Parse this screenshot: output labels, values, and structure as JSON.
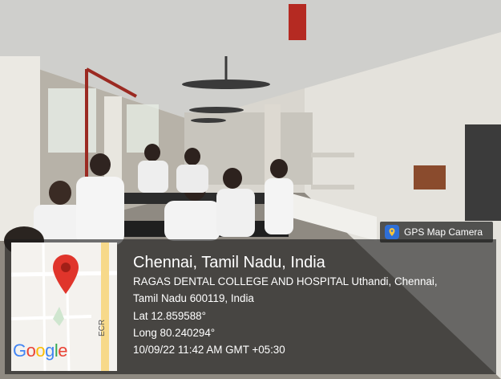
{
  "badge": {
    "label": "GPS Map Camera",
    "icon": "gps-map-camera-app-icon"
  },
  "location": {
    "city_line": "Chennai, Tamil Nadu, India",
    "address_line1": "RAGAS DENTAL COLLEGE AND HOSPITAL Uthandi, Chennai,",
    "address_line2": "Tamil Nadu 600119, India",
    "lat": "Lat 12.859588°",
    "long": "Long 80.240294°",
    "timestamp": "10/09/22 11:42 AM GMT +05:30"
  },
  "map": {
    "road_label": "ECR",
    "brand": "Google",
    "brand_colors": [
      "#4285F4",
      "#EA4335",
      "#FBBC05",
      "#4285F4",
      "#34A853",
      "#EA4335"
    ],
    "pin_color": "#E0352B",
    "pin_icon": "location-pin-icon"
  }
}
